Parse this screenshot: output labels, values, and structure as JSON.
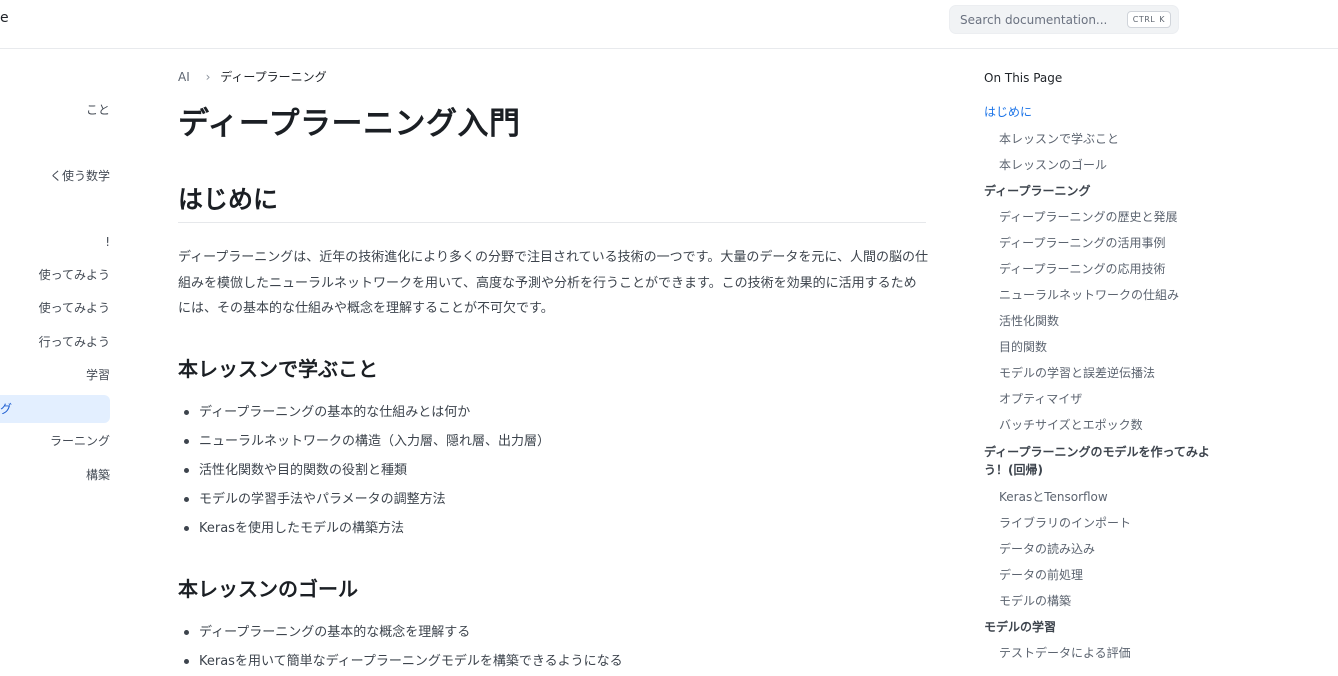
{
  "header": {
    "logo_fragment": "e",
    "search": {
      "placeholder": "Search documentation...",
      "kbd_ctrl": "CTRL",
      "kbd_key": "K"
    }
  },
  "sidebar": {
    "items": [
      {
        "label": "こと",
        "active": false
      },
      {
        "label": "く使う数学",
        "active": false
      },
      {
        "label": "!",
        "active": false
      },
      {
        "label": "使ってみよう",
        "active": false
      },
      {
        "label": "使ってみよう",
        "active": false
      },
      {
        "label": "行ってみよう",
        "active": false
      },
      {
        "label": "学習",
        "active": false
      },
      {
        "label": "グ",
        "active": true
      },
      {
        "label": "ラーニング",
        "active": false
      },
      {
        "label": "構築",
        "active": false
      }
    ]
  },
  "breadcrumb": {
    "root": "AI",
    "current": "ディープラーニング"
  },
  "page_title": "ディープラーニング入門",
  "section_intro": {
    "heading": "はじめに",
    "paragraph": "ディープラーニングは、近年の技術進化により多くの分野で注目されている技術の一つです。大量のデータを元に、人間の脳の仕組みを模倣したニューラルネットワークを用いて、高度な予測や分析を行うことができます。この技術を効果的に活用するためには、その基本的な仕組みや概念を理解することが不可欠です。"
  },
  "section_learn": {
    "heading": "本レッスンで学ぶこと",
    "items": [
      "ディープラーニングの基本的な仕組みとは何か",
      "ニューラルネットワークの構造（入力層、隠れ層、出力層）",
      "活性化関数や目的関数の役割と種類",
      "モデルの学習手法やパラメータの調整方法",
      "Kerasを使用したモデルの構築方法"
    ]
  },
  "section_goal": {
    "heading": "本レッスンのゴール",
    "items": [
      "ディープラーニングの基本的な概念を理解する",
      "Kerasを用いて簡単なディープラーニングモデルを構築できるようになる"
    ]
  },
  "toc": {
    "title": "On This Page",
    "items": [
      {
        "label": "はじめに",
        "level": 1,
        "active": true
      },
      {
        "label": "本レッスンで学ぶこと",
        "level": 2
      },
      {
        "label": "本レッスンのゴール",
        "level": 2
      },
      {
        "label": "ディープラーニング",
        "level": 1
      },
      {
        "label": "ディープラーニングの歴史と発展",
        "level": 2
      },
      {
        "label": "ディープラーニングの活用事例",
        "level": 2
      },
      {
        "label": "ディープラーニングの応用技術",
        "level": 2
      },
      {
        "label": "ニューラルネットワークの仕組み",
        "level": 2
      },
      {
        "label": "活性化関数",
        "level": 2
      },
      {
        "label": "目的関数",
        "level": 2
      },
      {
        "label": "モデルの学習と誤差逆伝播法",
        "level": 2
      },
      {
        "label": "オプティマイザ",
        "level": 2
      },
      {
        "label": "バッチサイズとエポック数",
        "level": 2
      },
      {
        "label": "ディープラーニングのモデルを作ってみよ",
        "level": 1
      },
      {
        "label": "う！(回帰)",
        "level": 1
      },
      {
        "label": "KerasとTensorflow",
        "level": 2
      },
      {
        "label": "ライブラリのインポート",
        "level": 2
      },
      {
        "label": "データの読み込み",
        "level": 2
      },
      {
        "label": "データの前処理",
        "level": 2
      },
      {
        "label": "モデルの構築",
        "level": 2
      },
      {
        "label": "モデルの学習",
        "level": 1
      },
      {
        "label": "テストデータによる評価",
        "level": 2
      }
    ]
  }
}
